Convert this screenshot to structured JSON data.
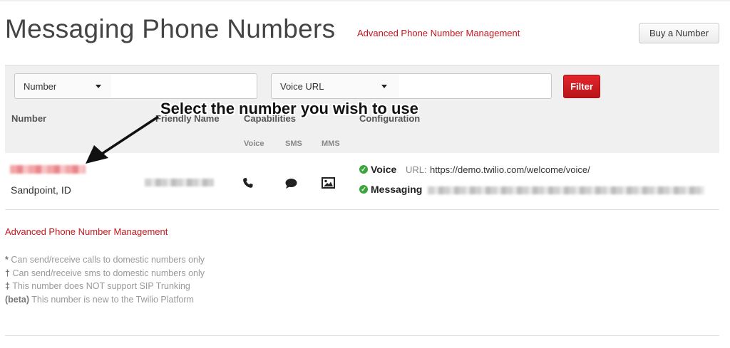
{
  "page": {
    "title": "Messaging Phone Numbers",
    "advanced_link": "Advanced Phone Number Management",
    "buy_button": "Buy a Number"
  },
  "filter": {
    "field1_select": "Number",
    "field1_value": "",
    "field2_select": "Voice URL",
    "field2_value": "",
    "filter_button": "Filter"
  },
  "table": {
    "headers": {
      "number": "Number",
      "friendly_name": "Friendly Name",
      "capabilities": "Capabilities",
      "configuration": "Configuration"
    },
    "capability_headers": [
      "Voice",
      "SMS",
      "MMS"
    ],
    "rows": [
      {
        "location": "Sandpoint, ID",
        "capability_icons": [
          "phone-icon",
          "chat-bubble-icon",
          "image-icon"
        ],
        "voice_label": "Voice",
        "url_label": "URL:",
        "voice_url": "https://demo.twilio.com/welcome/voice/",
        "messaging_label": "Messaging"
      }
    ]
  },
  "annotation": {
    "text": "Select the number you wish to use"
  },
  "footer": {
    "advanced_link": "Advanced Phone Number Management",
    "legend": [
      {
        "mark": "*",
        "text": "Can send/receive calls to domestic numbers only"
      },
      {
        "mark": "†",
        "text": "Can send/receive sms to domestic numbers only"
      },
      {
        "mark": "‡",
        "text": "This number does NOT support SIP Trunking"
      },
      {
        "mark": "(beta)",
        "text": "This number is new to the Twilio Platform"
      }
    ]
  },
  "colors": {
    "accent_red": "#c4161c",
    "check_green": "#3aa53a"
  }
}
